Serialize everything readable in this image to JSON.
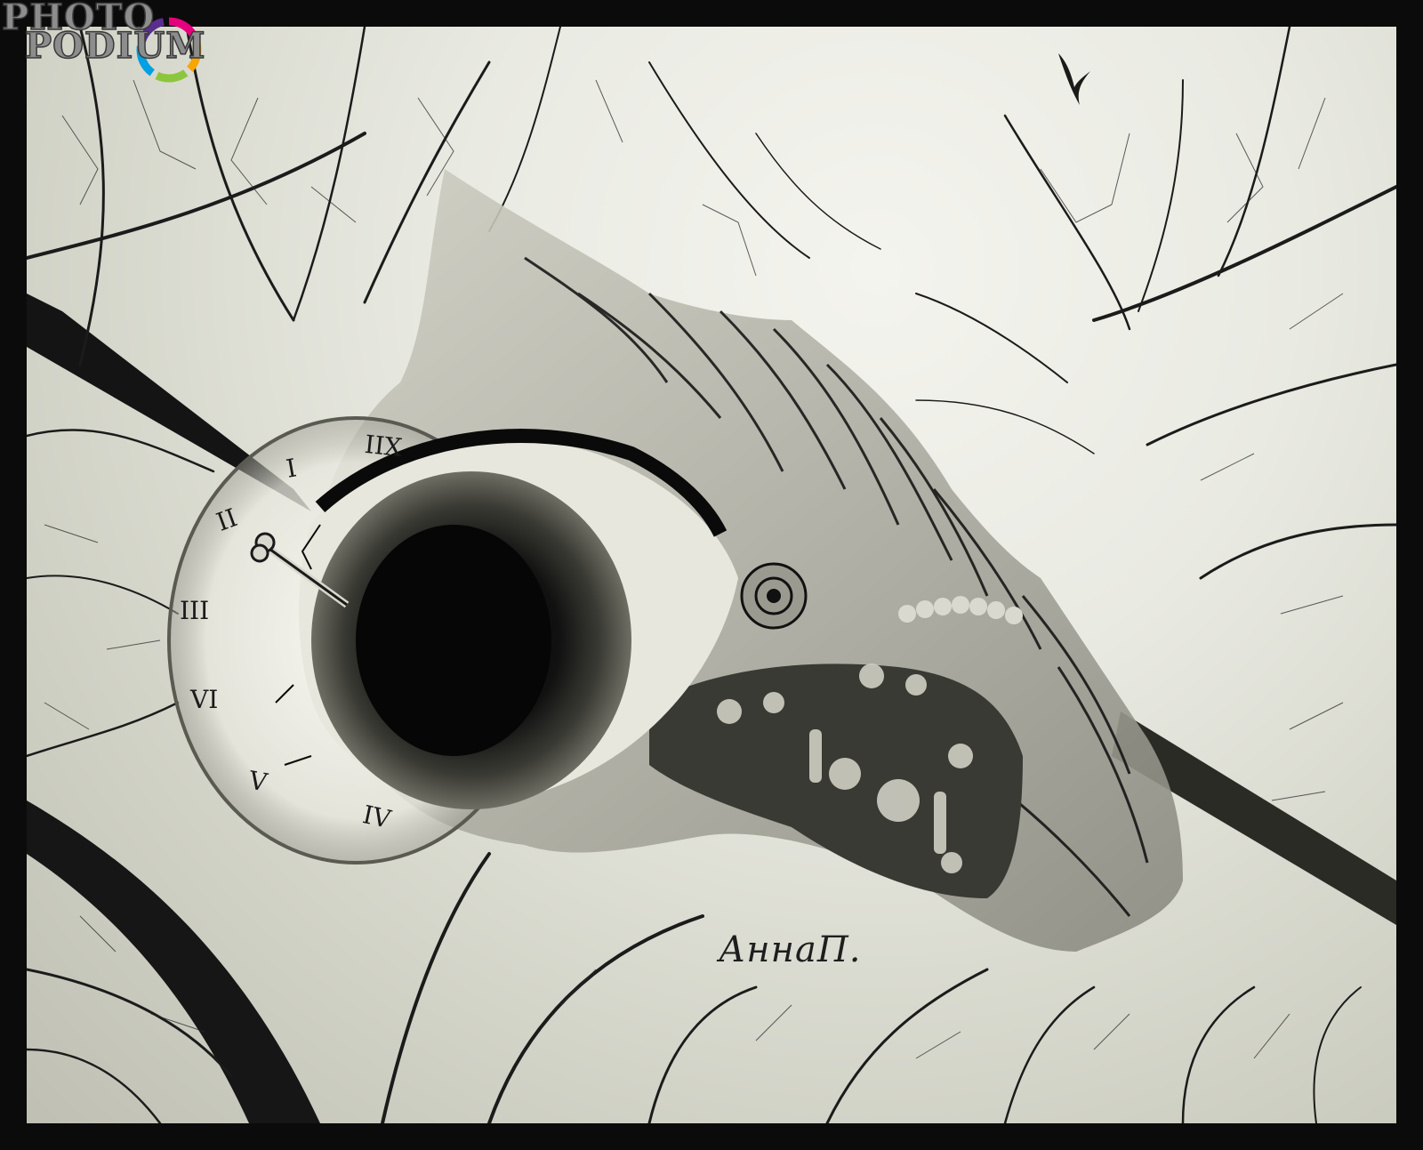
{
  "logo": {
    "line1": "PHOTO",
    "line2": "PODIUM"
  },
  "signature": "АннаП.",
  "clock": {
    "numerals": [
      "IIX",
      "I",
      "II",
      "III",
      "VI",
      "V",
      "IV"
    ]
  },
  "colors": {
    "frame": "#0b0b0b",
    "sky": "#eceee6",
    "ink": "#151515",
    "logo_ring": [
      "#e6007e",
      "#f7a600",
      "#00a0e3",
      "#8cc63e",
      "#5b2d8e"
    ]
  }
}
